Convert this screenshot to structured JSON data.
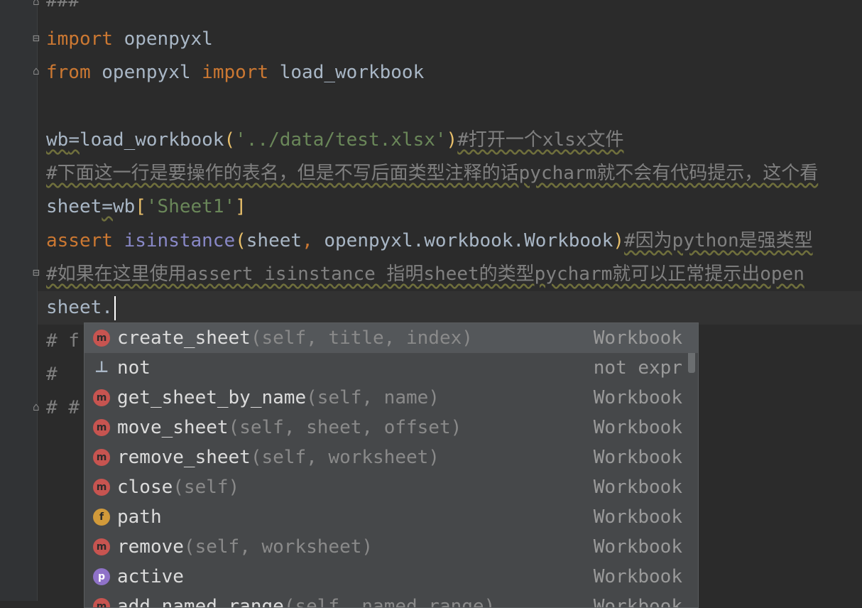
{
  "editor": {
    "line_top": "###",
    "line1": {
      "kw": "import",
      "rest": " openpyxl"
    },
    "line2": {
      "kw1": "from",
      "mid": " openpyxl ",
      "kw2": "import",
      "rest": " load_workbook"
    },
    "line4": {
      "a": "wb",
      "eq": "=",
      "fn": "load_workbook",
      "open": "(",
      "str": "'../data/test.xlsx'",
      "close": ")",
      "cmt": "#打开一个xlsx文件"
    },
    "line5": "#下面这一行是要操作的表名，但是不写后面类型注释的话pycharm就不会有代码提示，这个看",
    "line6": {
      "a": "sheet",
      "eq": "=",
      "b": "wb",
      "open": "[",
      "str": "'Sheet1'",
      "close": "]"
    },
    "line7": {
      "kw": "assert",
      "sp": " ",
      "builtin": "isinstance",
      "open": "(",
      "arg1": "sheet",
      "comma": ", ",
      "arg2": "openpyxl.workbook.Workbook",
      "close": ")",
      "cmt": "#因为python是强类型"
    },
    "line8": "#如果在这里使用assert isinstance 指明sheet的类型pycharm就可以正常提示出open",
    "line9": "sheet.",
    "line10": "# f",
    "line11": "#",
    "line12": "# #"
  },
  "completion": {
    "items": [
      {
        "icon": "m",
        "kind": "method",
        "name": "create_sheet",
        "params": "(self, title, index)",
        "type": "Workbook",
        "selected": true
      },
      {
        "icon": "⊥",
        "kind": "keyword",
        "name": "not",
        "params": "",
        "type": "not expr",
        "selected": false
      },
      {
        "icon": "m",
        "kind": "method",
        "name": "get_sheet_by_name",
        "params": "(self, name)",
        "type": "Workbook",
        "selected": false
      },
      {
        "icon": "m",
        "kind": "method",
        "name": "move_sheet",
        "params": "(self, sheet, offset)",
        "type": "Workbook",
        "selected": false
      },
      {
        "icon": "m",
        "kind": "method",
        "name": "remove_sheet",
        "params": "(self, worksheet)",
        "type": "Workbook",
        "selected": false
      },
      {
        "icon": "m",
        "kind": "method",
        "name": "close",
        "params": "(self)",
        "type": "Workbook",
        "selected": false
      },
      {
        "icon": "f",
        "kind": "field",
        "name": "path",
        "params": "",
        "type": "Workbook",
        "selected": false
      },
      {
        "icon": "m",
        "kind": "method",
        "name": "remove",
        "params": "(self, worksheet)",
        "type": "Workbook",
        "selected": false
      },
      {
        "icon": "p",
        "kind": "property",
        "name": "active",
        "params": "",
        "type": "Workbook",
        "selected": false
      },
      {
        "icon": "m",
        "kind": "method",
        "name": "add_named_range",
        "params": "(self, named_range)",
        "type": "Workbook",
        "selected": false
      }
    ]
  },
  "colors": {
    "background": "#2b2b2b",
    "keyword": "#cc7832",
    "string": "#6a8759",
    "comment": "#808080",
    "builtin": "#8888c6",
    "method_icon": "#c75450",
    "field_icon": "#d19a3a",
    "property_icon": "#8f72c8"
  }
}
